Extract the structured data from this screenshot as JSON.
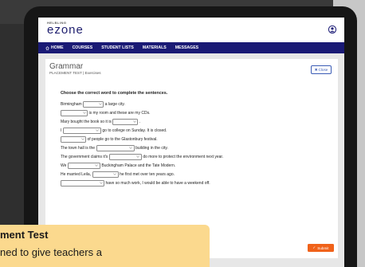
{
  "brand": {
    "small": "HELBLING",
    "main": "ezone"
  },
  "nav": [
    {
      "label": "HOME",
      "icon": "home-icon"
    },
    {
      "label": "COURSES"
    },
    {
      "label": "STUDENT LISTS"
    },
    {
      "label": "MATERIALS"
    },
    {
      "label": "MESSAGES"
    }
  ],
  "page": {
    "title": "Grammar",
    "subtitle": "PLACEMENT TEST | Exercises",
    "close_label": "Close",
    "instruction": "Choose the correct word to complete the sentences.",
    "submit_label": "Submit"
  },
  "sentences": [
    {
      "before": "Birmingham",
      "after": "a large city."
    },
    {
      "before": "",
      "after": "is my room and these are my CDs."
    },
    {
      "before": "Mary bought the book so it is",
      "after": "."
    },
    {
      "before": "I",
      "after": "go to college on Sunday. It is closed."
    },
    {
      "before": "",
      "after": "of people go to the Glastonbury festival."
    },
    {
      "before": "The town hall is the",
      "after": "building in the city."
    },
    {
      "before": "The government claims it's",
      "after": "do more to protect the environment next year."
    },
    {
      "before": "We",
      "after": "Buckingham Palace and the Tate Modern."
    },
    {
      "before": "He married Leila,",
      "after": "he first met over ten years ago."
    },
    {
      "before": "",
      "after": "have so much work, I would be able to have a weekend off."
    }
  ],
  "callout": {
    "title": "ment Test",
    "body": "ned to give teachers a"
  },
  "colors": {
    "nav_bg": "#1a1a75",
    "accent_orange": "#f0621a",
    "callout_bg": "#fbd98e",
    "link_blue": "#3a5bb5"
  }
}
